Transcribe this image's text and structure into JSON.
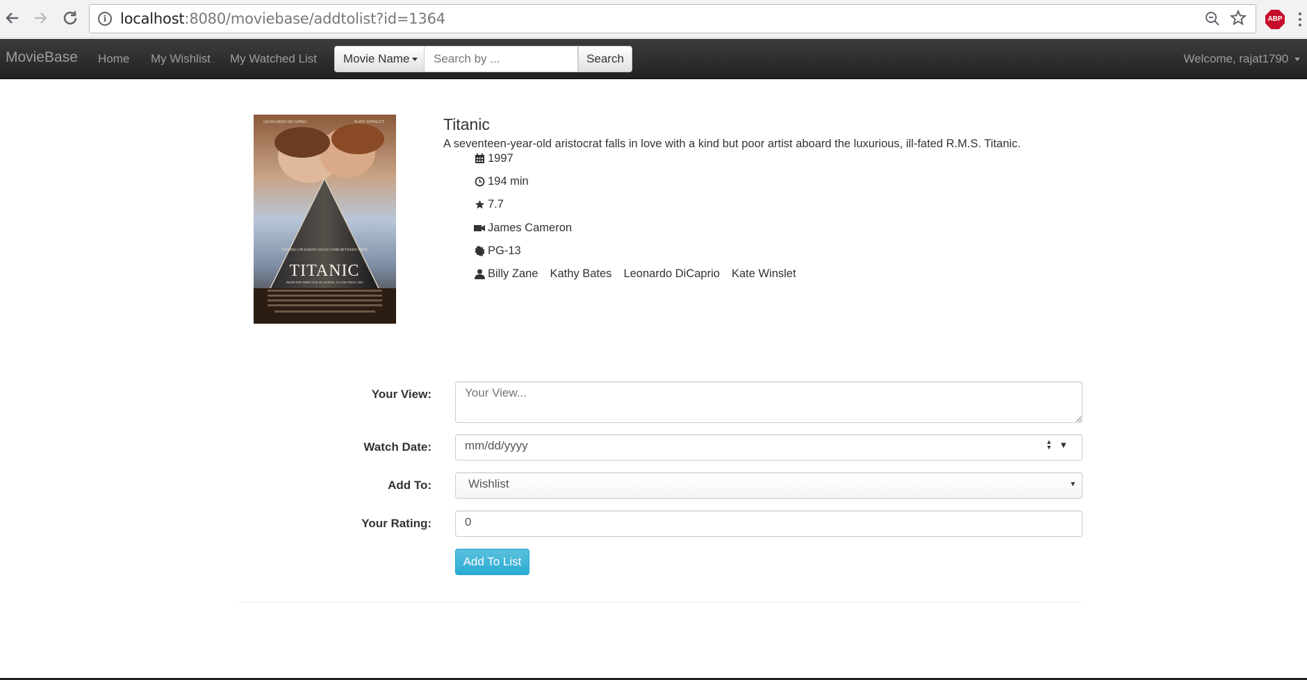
{
  "browser": {
    "url_host": "localhost",
    "url_rest": ":8080/moviebase/addtolist?id=1364",
    "adblock_label": "ABP"
  },
  "navbar": {
    "brand": "MovieBase",
    "links": [
      "Home",
      "My Wishlist",
      "My Watched List"
    ],
    "search": {
      "dropdown_label": "Movie Name",
      "placeholder": "Search by ...",
      "button_label": "Search"
    },
    "welcome": "Welcome, rajat1790"
  },
  "poster": {
    "top_left_credit": "LEONARDO DiCAPRIO",
    "top_right_credit": "KATE WINSLET",
    "tagline": "NOTHING ON EARTH COULD COME BETWEEN THEM",
    "title_text": "TITANIC",
    "subline": "FROM THE DIRECTOR OF ALIENS, T2 AND TRUE LIES"
  },
  "movie": {
    "title": "Titanic",
    "description": "A seventeen-year-old aristocrat falls in love with a kind but poor artist aboard the luxurious, ill-fated R.M.S. Titanic.",
    "year": "1997",
    "runtime": "194 min",
    "rating": "7.7",
    "director": "James Cameron",
    "certificate": "PG-13",
    "cast": [
      "Billy Zane",
      "Kathy Bates",
      "Leonardo DiCaprio",
      "Kate Winslet"
    ]
  },
  "form": {
    "view_label": "Your View:",
    "view_placeholder": "Your View...",
    "date_label": "Watch Date:",
    "date_value": "mm/dd/yyyy",
    "addto_label": "Add To:",
    "addto_value": "Wishlist",
    "rating_label": "Your Rating:",
    "rating_value": "0",
    "submit_label": "Add To List"
  },
  "colors": {
    "navbar_bg": "#222222",
    "info_button": "#5bc0de",
    "adblock_red": "#c70d2c"
  }
}
